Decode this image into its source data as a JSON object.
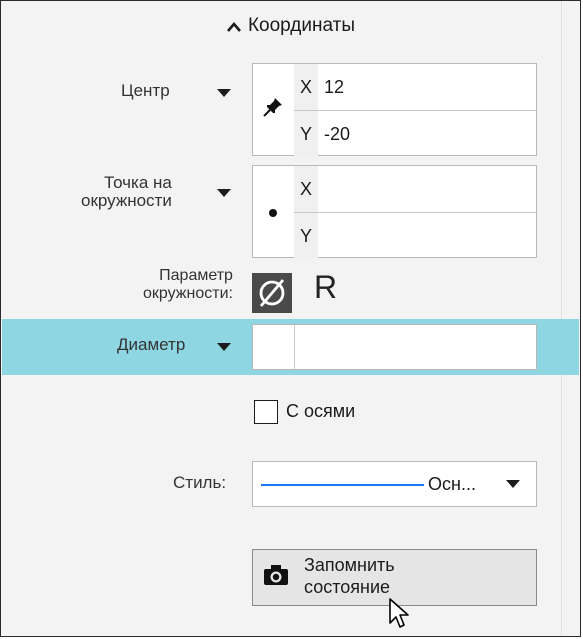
{
  "section": {
    "title": "Координаты"
  },
  "center": {
    "label": "Центр",
    "x_axis": "X",
    "x_value": "12",
    "y_axis": "Y",
    "y_value": "-20"
  },
  "circle_point": {
    "label_line1": "Точка на",
    "label_line2": "окружности",
    "x_axis": "X",
    "x_value": "",
    "y_axis": "Y",
    "y_value": ""
  },
  "circle_param": {
    "label_line1": "Параметр",
    "label_line2": "окружности:",
    "radius_option": "R"
  },
  "diameter": {
    "label": "Диаметр",
    "value": ""
  },
  "axes_checkbox": {
    "label": "С осями",
    "checked": false
  },
  "style": {
    "label": "Стиль:",
    "value": "Осн...",
    "line_color": "#1a75ff"
  },
  "save_state_button": {
    "line1": "Запомнить",
    "line2": "состояние"
  },
  "colors": {
    "highlight": "#8ed7e2",
    "panel": "#f3f3f3"
  },
  "icons": {
    "header": "chevron-up-icon",
    "center": "pin-icon",
    "circle_point": "dot-icon",
    "diameter_option": "diameter-icon",
    "button": "camera-icon"
  }
}
